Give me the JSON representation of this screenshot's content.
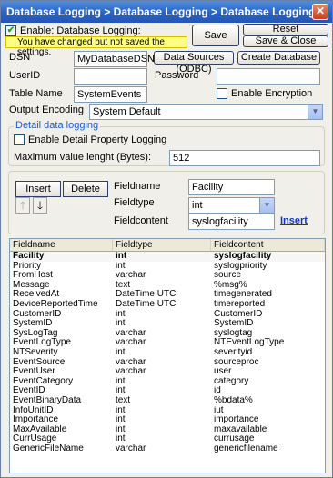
{
  "window": {
    "title": "Database Logging > Database Logging > Database Logging",
    "close_glyph": "✕"
  },
  "top": {
    "enable_label": "Enable: Database Logging:",
    "enable_checked": true,
    "warning": "You have changed but not saved the settings.",
    "save_label": "Save",
    "reset_label": "Reset",
    "save_close_label": "Save & Close"
  },
  "connection": {
    "dsn_label": "DSN",
    "dsn_value": "MyDatabaseDSN",
    "data_sources_label": "Data Sources (ODBC)",
    "create_db_label": "Create Database",
    "userid_label": "UserID",
    "userid_value": "",
    "password_label": "Password",
    "password_value": "",
    "table_label": "Table Name",
    "table_value": "SystemEvents",
    "encryption_label": "Enable Encryption",
    "encryption_checked": false,
    "encoding_label": "Output Encoding",
    "encoding_value": "System Default"
  },
  "detail": {
    "group_title": "Detail data logging",
    "enable_label": "Enable Detail Property Logging",
    "enable_checked": false,
    "max_label": "Maximum value lenght (Bytes):",
    "max_value": "512"
  },
  "editor": {
    "insert_label": "Insert",
    "delete_label": "Delete",
    "up_glyph": "🡑",
    "down_glyph": "🡓",
    "fieldname_label": "Fieldname",
    "fieldname_value": "Facility",
    "fieldtype_label": "Fieldtype",
    "fieldtype_value": "int",
    "fieldcontent_label": "Fieldcontent",
    "fieldcontent_value": "syslogfacility",
    "insert_link": "Insert"
  },
  "grid": {
    "headers": [
      "Fieldname",
      "Fieldtype",
      "Fieldcontent"
    ],
    "rows": [
      [
        "Facility",
        "int",
        "syslogfacility"
      ],
      [
        "Priority",
        "int",
        "syslogpriority"
      ],
      [
        "FromHost",
        "varchar",
        "source"
      ],
      [
        "Message",
        "text",
        "%msg%"
      ],
      [
        "ReceivedAt",
        "DateTime UTC",
        "timegenerated"
      ],
      [
        "DeviceReportedTime",
        "DateTime UTC",
        "timereported"
      ],
      [
        "CustomerID",
        "int",
        "CustomerID"
      ],
      [
        "SystemID",
        "int",
        "SystemID"
      ],
      [
        "SysLogTag",
        "varchar",
        "syslogtag"
      ],
      [
        "EventLogType",
        "varchar",
        "NTEventLogType"
      ],
      [
        "NTSeverity",
        "int",
        "severityid"
      ],
      [
        "EventSource",
        "varchar",
        "sourceproc"
      ],
      [
        "EventUser",
        "varchar",
        "user"
      ],
      [
        "EventCategory",
        "int",
        "category"
      ],
      [
        "EventID",
        "int",
        "id"
      ],
      [
        "EventBinaryData",
        "text",
        "%bdata%"
      ],
      [
        "InfoUnitID",
        "int",
        "iut"
      ],
      [
        "Importance",
        "int",
        "importance"
      ],
      [
        "MaxAvailable",
        "int",
        "maxavailable"
      ],
      [
        "CurrUsage",
        "int",
        "currusage"
      ],
      [
        "GenericFileName",
        "varchar",
        "genericfilename"
      ]
    ]
  }
}
